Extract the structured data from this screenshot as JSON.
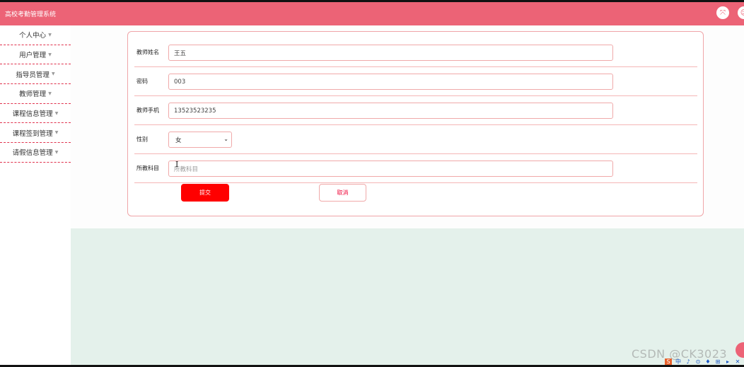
{
  "app": {
    "title": "高校考勤管理系统"
  },
  "header": {
    "fullscreen_icon": "fullscreen-icon",
    "user_icon": "user-icon"
  },
  "sidebar": {
    "items": [
      {
        "label": "个人中心"
      },
      {
        "label": "用户管理"
      },
      {
        "label": "指导员管理"
      },
      {
        "label": "教师管理"
      },
      {
        "label": "课程信息管理"
      },
      {
        "label": "课程签到管理"
      },
      {
        "label": "请假信息管理"
      }
    ]
  },
  "form": {
    "fields": [
      {
        "label": "教师姓名",
        "value": "王五"
      },
      {
        "label": "密码",
        "value": "003"
      },
      {
        "label": "教师手机",
        "value": "13523523235"
      },
      {
        "label": "性别",
        "value": "女"
      },
      {
        "label": "所教科目",
        "value": "",
        "placeholder": "所教科目"
      }
    ],
    "submit_label": "提交",
    "cancel_label": "取消"
  },
  "overlay": {
    "watermark": "CSDN @CK3023",
    "tray": [
      "S",
      "中",
      "♪",
      "⊙",
      "♦",
      "⊞",
      "▸",
      "✕"
    ]
  },
  "colors": {
    "header": "#ec6376",
    "submit": "#ff0000",
    "content_bg": "#e4f1eb",
    "border_pink": "#f0a9a9",
    "divider_red": "#e0324d"
  }
}
